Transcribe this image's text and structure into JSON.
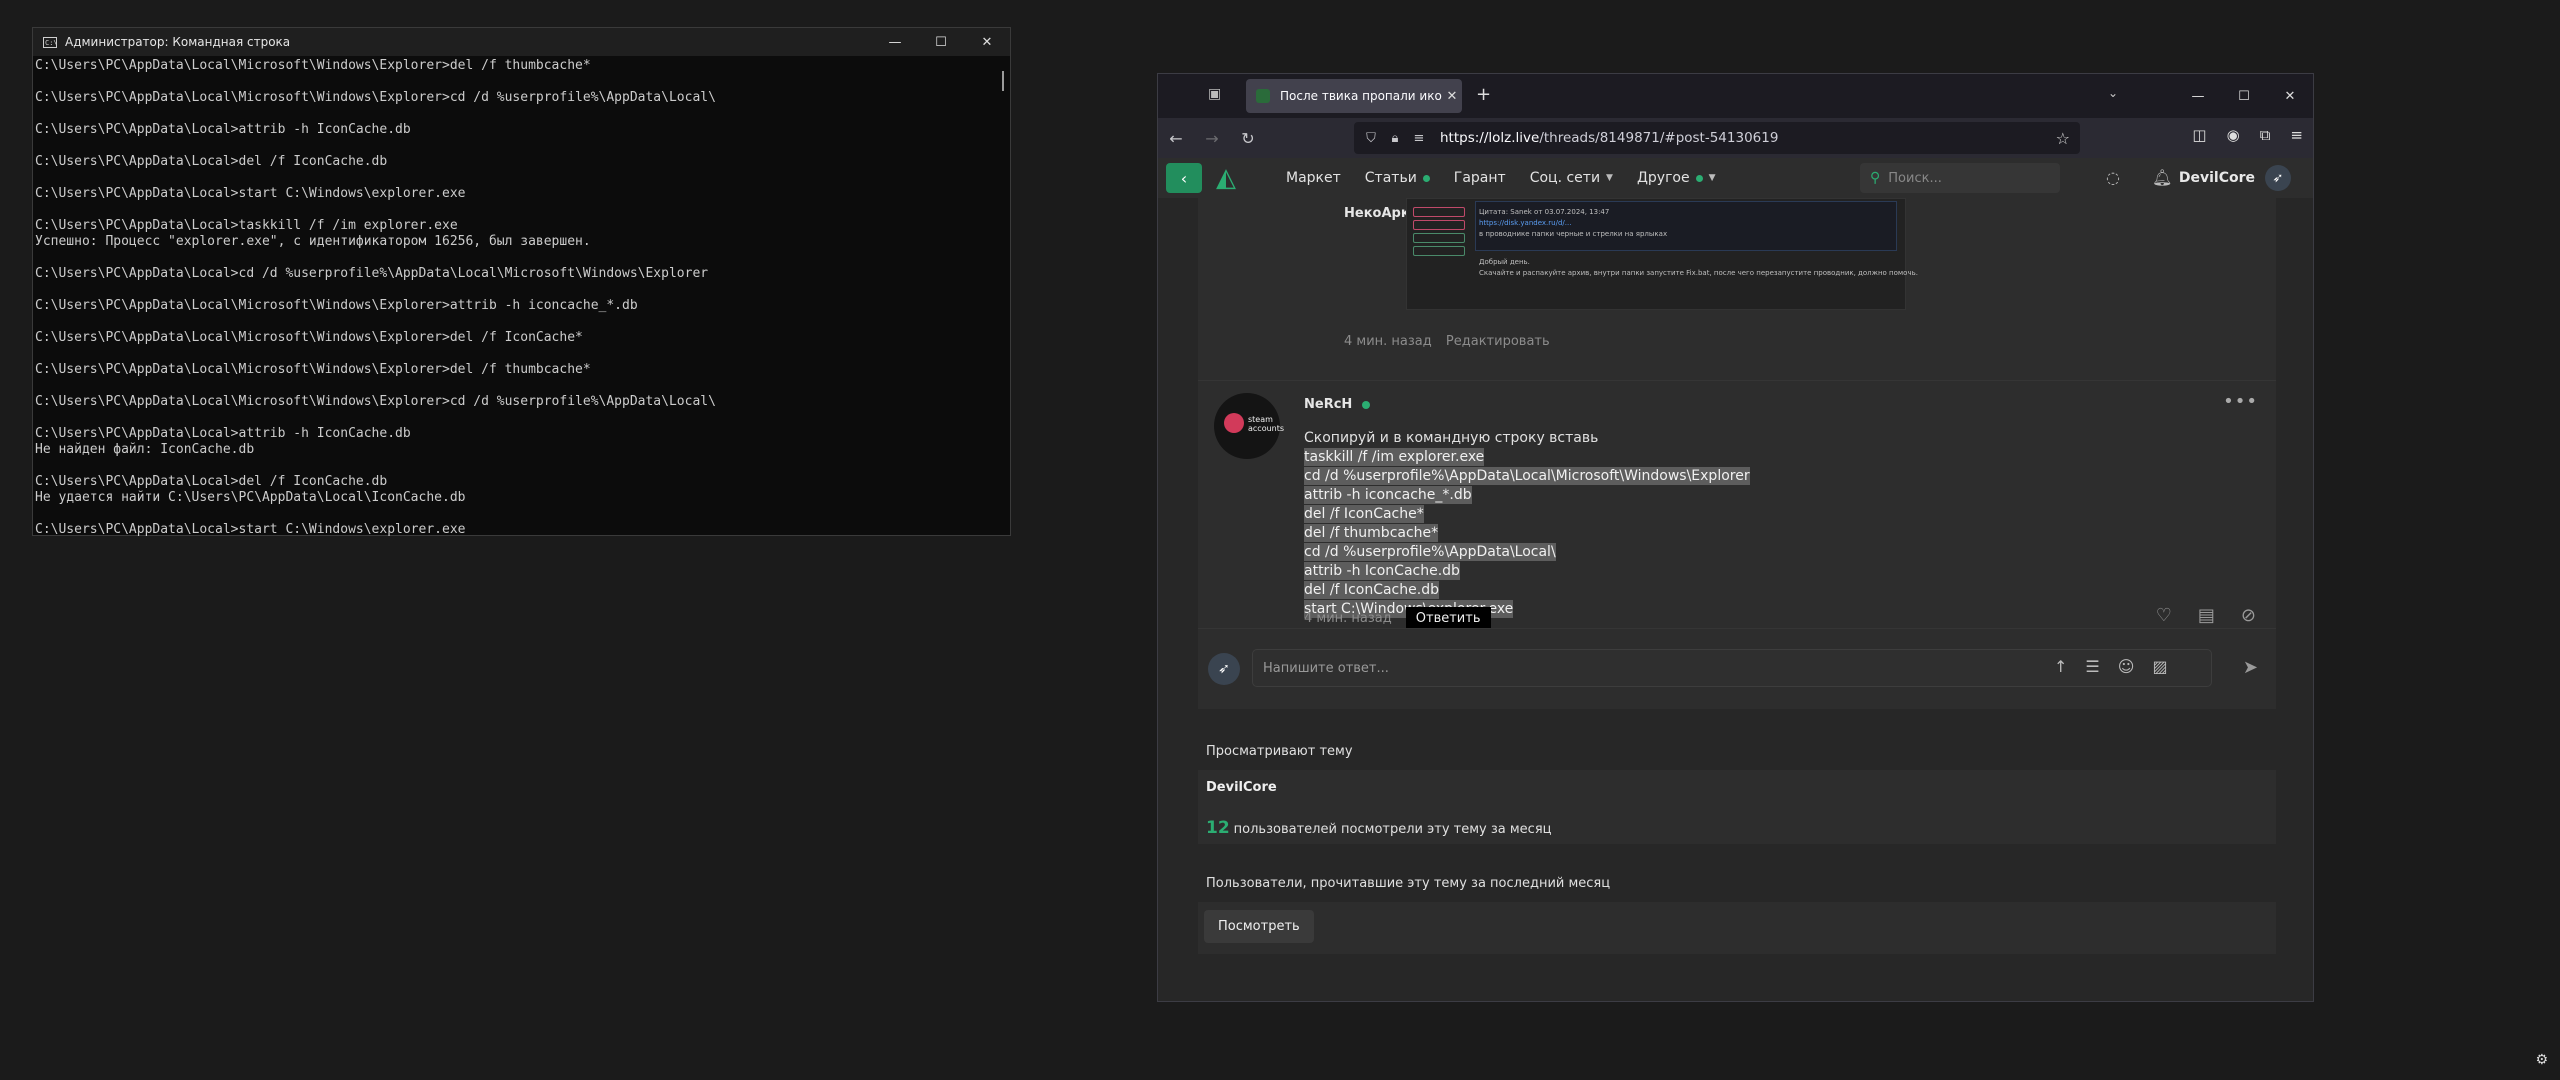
{
  "cmd": {
    "title": "Администратор: Командная строка",
    "lines": [
      "C:\\Users\\PC\\AppData\\Local\\Microsoft\\Windows\\Explorer>del /f thumbcache*",
      "",
      "C:\\Users\\PC\\AppData\\Local\\Microsoft\\Windows\\Explorer>cd /d %userprofile%\\AppData\\Local\\",
      "",
      "C:\\Users\\PC\\AppData\\Local>attrib -h IconCache.db",
      "",
      "C:\\Users\\PC\\AppData\\Local>del /f IconCache.db",
      "",
      "C:\\Users\\PC\\AppData\\Local>start C:\\Windows\\explorer.exe",
      "",
      "C:\\Users\\PC\\AppData\\Local>taskkill /f /im explorer.exe",
      "Успешно: Процесс \"explorer.exe\", с идентификатором 16256, был завершен.",
      "",
      "C:\\Users\\PC\\AppData\\Local>cd /d %userprofile%\\AppData\\Local\\Microsoft\\Windows\\Explorer",
      "",
      "C:\\Users\\PC\\AppData\\Local\\Microsoft\\Windows\\Explorer>attrib -h iconcache_*.db",
      "",
      "C:\\Users\\PC\\AppData\\Local\\Microsoft\\Windows\\Explorer>del /f IconCache*",
      "",
      "C:\\Users\\PC\\AppData\\Local\\Microsoft\\Windows\\Explorer>del /f thumbcache*",
      "",
      "C:\\Users\\PC\\AppData\\Local\\Microsoft\\Windows\\Explorer>cd /d %userprofile%\\AppData\\Local\\",
      "",
      "C:\\Users\\PC\\AppData\\Local>attrib -h IconCache.db",
      "Не найден файл: IconCache.db",
      "",
      "C:\\Users\\PC\\AppData\\Local>del /f IconCache.db",
      "Не удается найти C:\\Users\\PC\\AppData\\Local\\IconCache.db",
      "",
      "C:\\Users\\PC\\AppData\\Local>start C:\\Windows\\explorer.exe"
    ]
  },
  "browser": {
    "tab_title": "После твика пропали иконки",
    "url_host": "https://lolz.live",
    "url_path": "/threads/8149871/#post-54130619"
  },
  "site": {
    "menu": [
      {
        "label": "Маркет",
        "dot": false,
        "chevron": false
      },
      {
        "label": "Статьи",
        "dot": true,
        "chevron": false
      },
      {
        "label": "Гарант",
        "dot": false,
        "chevron": false
      },
      {
        "label": "Соц. сети",
        "dot": false,
        "chevron": true
      },
      {
        "label": "Другое",
        "dot": true,
        "chevron": true
      }
    ],
    "search_placeholder": "Поиск...",
    "username": "DevilCore"
  },
  "post_prev": {
    "nick": "НекоАрк.",
    "quote_lines": [
      "Цитата: Sanek от 03.07.2024, 13:47",
      "https://disk.yandex.ru/d/...",
      "в проводнике папки черные и стрелки на ярлыках"
    ],
    "body_lines": [
      "Добрый день.",
      "Скачайте и распакуйте архив, внутри папки запустите Fix.bat, после чего перезапустите проводник, должно помочь."
    ],
    "time": "4 мин. назад",
    "edit": "Редактировать"
  },
  "post": {
    "author": "NeRcH",
    "avatar_text": [
      "steam",
      "accounts"
    ],
    "intro": "Скопируй и в командную строку вставь",
    "code_lines": [
      "taskkill /f /im explorer.exe",
      "cd /d %userprofile%\\AppData\\Local\\Microsoft\\Windows\\Explorer",
      "attrib -h iconcache_*.db",
      "del /f IconCache*",
      "del /f thumbcache*",
      "cd /d %userprofile%\\AppData\\Local\\",
      "attrib -h IconCache.db",
      "del /f IconCache.db",
      "start C:\\Windows\\explorer.exe"
    ],
    "time": "4 мин. назад",
    "reply": "Ответить"
  },
  "composer": {
    "placeholder": "Напишите ответ..."
  },
  "viewers": {
    "title": "Просматривают тему",
    "name": "DevilCore",
    "count": "12",
    "stat_text": "пользователей посмотрели эту тему за месяц"
  },
  "readers": {
    "title": "Пользователи, прочитавшие эту тему за последний месяц",
    "button": "Посмотреть"
  }
}
